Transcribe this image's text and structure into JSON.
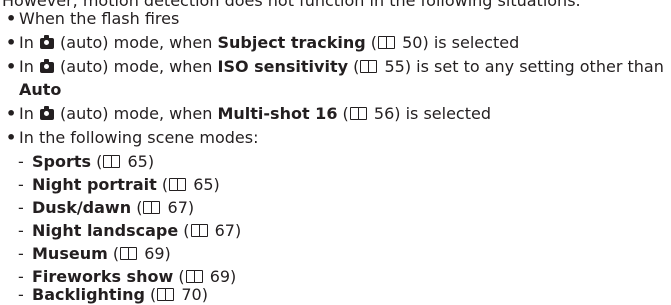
{
  "intro_partial": "However, motion detection does not function in the following situations.",
  "bullets": {
    "b1": {
      "text": "When the flash fires"
    },
    "b2": {
      "pre": "In",
      "mid": "(auto) mode, when",
      "bold": "Subject tracking",
      "open": "(",
      "page": "50",
      "post": ") is selected"
    },
    "b3": {
      "pre": "In",
      "mid": "(auto) mode, when",
      "bold": "ISO sensitivity",
      "open": "(",
      "page": "55",
      "post": ") is set to any setting other than",
      "bold2": "Auto"
    },
    "b4": {
      "pre": "In",
      "mid": "(auto) mode, when",
      "bold": "Multi-shot 16",
      "open": "(",
      "page": "56",
      "post": ") is selected"
    },
    "b5": {
      "text": "In the following scene modes:"
    }
  },
  "scene_modes": [
    {
      "dash": "-",
      "name": "Sports",
      "open": "(",
      "page": "65",
      "close": ")"
    },
    {
      "dash": "-",
      "name": "Night portrait",
      "open": "(",
      "page": "65",
      "close": ")"
    },
    {
      "dash": "-",
      "name": "Dusk/dawn",
      "open": "(",
      "page": "67",
      "close": ")"
    },
    {
      "dash": "-",
      "name": "Night landscape",
      "open": "(",
      "page": "67",
      "close": ")"
    },
    {
      "dash": "-",
      "name": "Museum",
      "open": "(",
      "page": "69",
      "close": ")"
    },
    {
      "dash": "-",
      "name": "Fireworks show",
      "open": "(",
      "page": "69",
      "close": ")"
    },
    {
      "dash": "-",
      "name": "Backlighting",
      "open": "(",
      "page": "70",
      "close": ")"
    }
  ],
  "bullet_glyph": "•",
  "icons": {
    "mode": "camera-auto-icon",
    "ref": "book-reference-icon"
  },
  "colors": {
    "text": "#231f20",
    "background": "#ffffff"
  }
}
